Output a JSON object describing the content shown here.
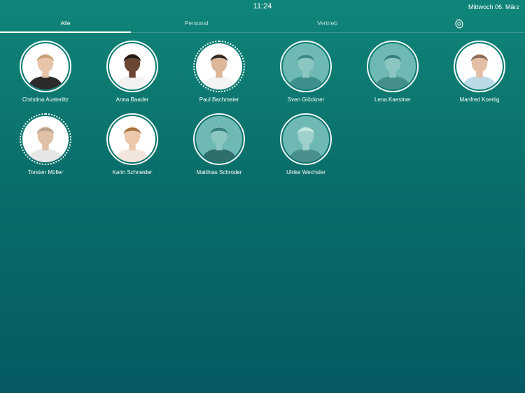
{
  "status": {
    "time": "11:24",
    "date": "Mittwoch 06. März"
  },
  "tabs": [
    {
      "label": "Alle",
      "active": true
    },
    {
      "label": "Personal",
      "active": false
    },
    {
      "label": "Vertrieb",
      "active": false
    }
  ],
  "settings_icon": "gear-icon",
  "people": [
    {
      "name": "Christina Austerlitz",
      "present": true,
      "hair": "#c9a27a",
      "shirt": "#2b2b2b",
      "skin": "#e8c4a8"
    },
    {
      "name": "Anna Baader",
      "present": true,
      "hair": "#1e1a18",
      "shirt": "#f2f2f2",
      "skin": "#6b4632"
    },
    {
      "name": "Paul Bachmeier",
      "present": true,
      "hair": "#2e2a28",
      "shirt": "#f4f4f4",
      "skin": "#dcb79a"
    },
    {
      "name": "Sven Glöckner",
      "present": false,
      "hair": "#3b8a86",
      "shirt": "#3c8f8a",
      "skin": "#8bc6c1"
    },
    {
      "name": "Lena Kaestner",
      "present": false,
      "hair": "#357f7b",
      "shirt": "#458f8b",
      "skin": "#8bc6c1"
    },
    {
      "name": "Manfred Koertig",
      "present": true,
      "hair": "#8a6c58",
      "shirt": "#bcd9e6",
      "skin": "#e2bfa4"
    },
    {
      "name": "Torsten Müller",
      "present": true,
      "hair": "#b8a088",
      "shirt": "#e6e6e6",
      "skin": "#e0c0a6"
    },
    {
      "name": "Karin Schneider",
      "present": true,
      "hair": "#a5723f",
      "shirt": "#f2e6dc",
      "skin": "#ecc7aa"
    },
    {
      "name": "Matthias Schroder",
      "present": false,
      "hair": "#357f7b",
      "shirt": "#2f6f6b",
      "skin": "#8bc6c1"
    },
    {
      "name": "Ulrike Wechsler",
      "present": false,
      "hair": "#c6e6e2",
      "shirt": "#4a918d",
      "skin": "#9dd0cb"
    }
  ]
}
